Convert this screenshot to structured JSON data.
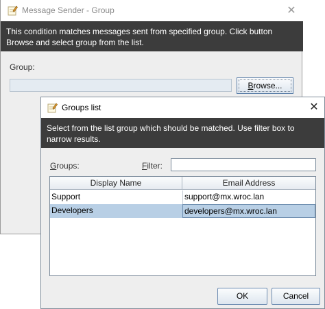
{
  "background_window": {
    "title": "Message Sender - Group",
    "banner": "This condition matches messages sent from specified group. Click button Browse and select group from the list.",
    "group_label": "Group:",
    "group_value": "",
    "browse_button": "Browse...",
    "close_glyph": "✕"
  },
  "dialog": {
    "title": "Groups list",
    "banner": "Select from the list group which should be matched. Use filter box to narrow results.",
    "groups_label": "Groups:",
    "filter_label": "Filter:",
    "filter_value": "",
    "close_glyph": "✕",
    "table": {
      "columns": [
        "Display Name",
        "Email Address"
      ],
      "rows": [
        {
          "name": "Support",
          "email": "support@mx.wroc.lan",
          "selected": false
        },
        {
          "name": "Developers",
          "email": "developers@mx.wroc.lan",
          "selected": true
        }
      ]
    },
    "ok_button": "OK",
    "cancel_button": "Cancel"
  },
  "icons": {
    "window_icon": "notepad-pencil-icon",
    "close_icon": "close-icon"
  },
  "colors": {
    "banner": "#3c3c3c",
    "selected_row": "#b8cfe5",
    "window_bg": "#eeeeee"
  }
}
